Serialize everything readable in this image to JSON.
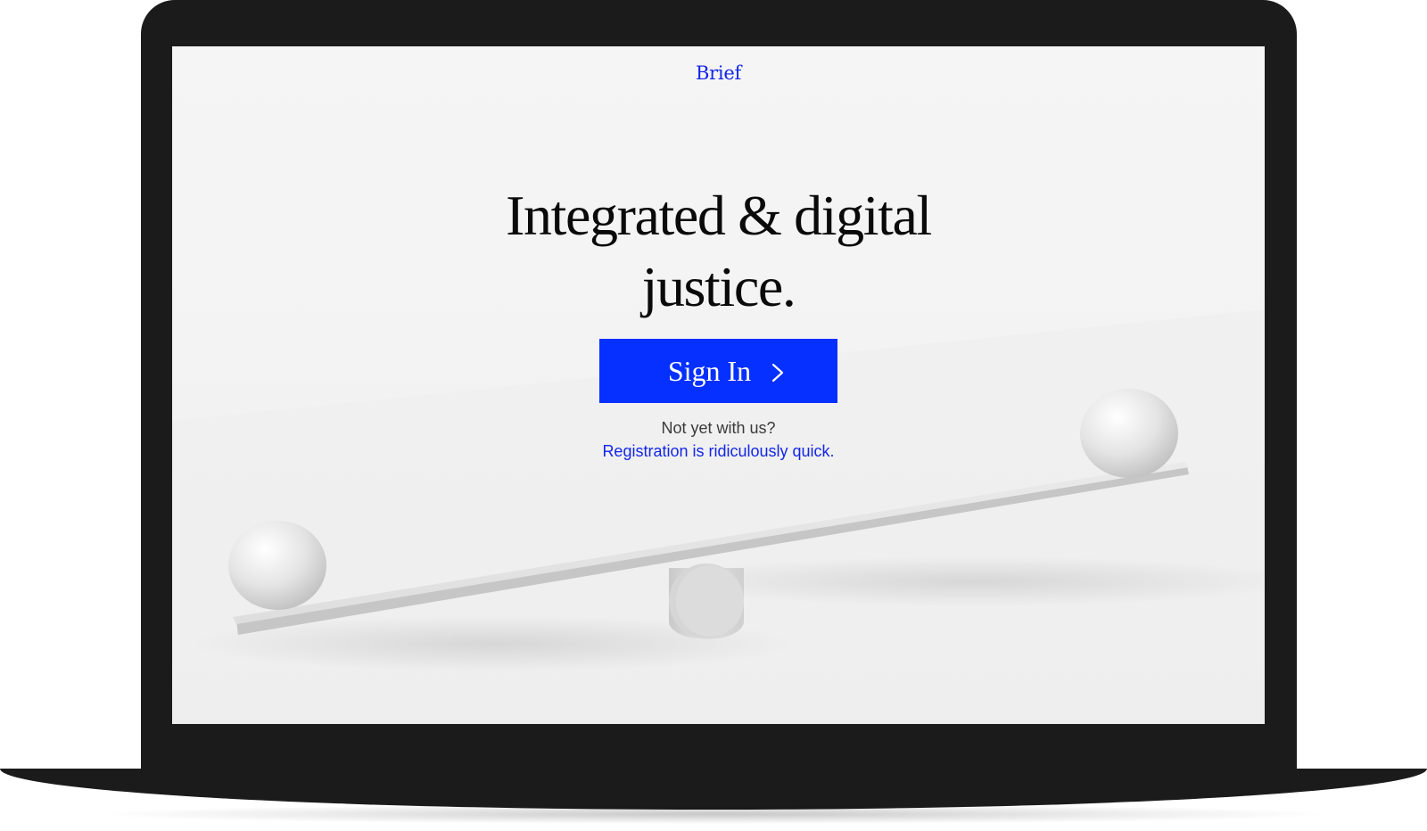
{
  "brand": "Brief",
  "hero": {
    "headline_line1": "Integrated & digital",
    "headline_line2": "justice."
  },
  "signin": {
    "label": "Sign In",
    "icon": "chevron-right-icon"
  },
  "registration": {
    "prompt": "Not yet with us?",
    "link_label": "Registration is ridiculously quick."
  },
  "colors": {
    "accent": "#0530ff",
    "link": "#1326e6",
    "frame": "#1b1b1b",
    "screen_bg": "#f4f4f4"
  }
}
